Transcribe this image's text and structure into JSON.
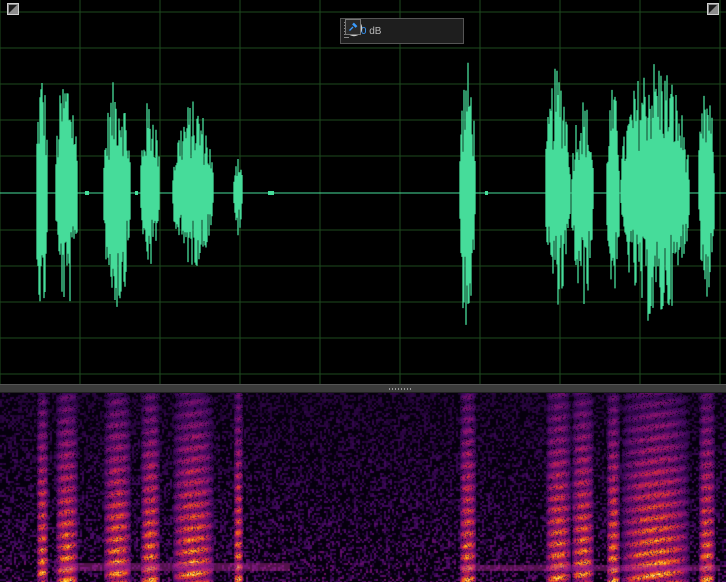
{
  "toolbar": {
    "gain_value": "+0",
    "gain_unit": "dB",
    "icons": [
      "level-meter-icon",
      "gain-knob-icon",
      "pin-icon"
    ]
  },
  "colors": {
    "waveform": "#46dc9a",
    "grid": "#1e4a1e",
    "background": "#000000",
    "gain_text": "#3a9cff",
    "splitter": "#3a3a3a"
  }
}
